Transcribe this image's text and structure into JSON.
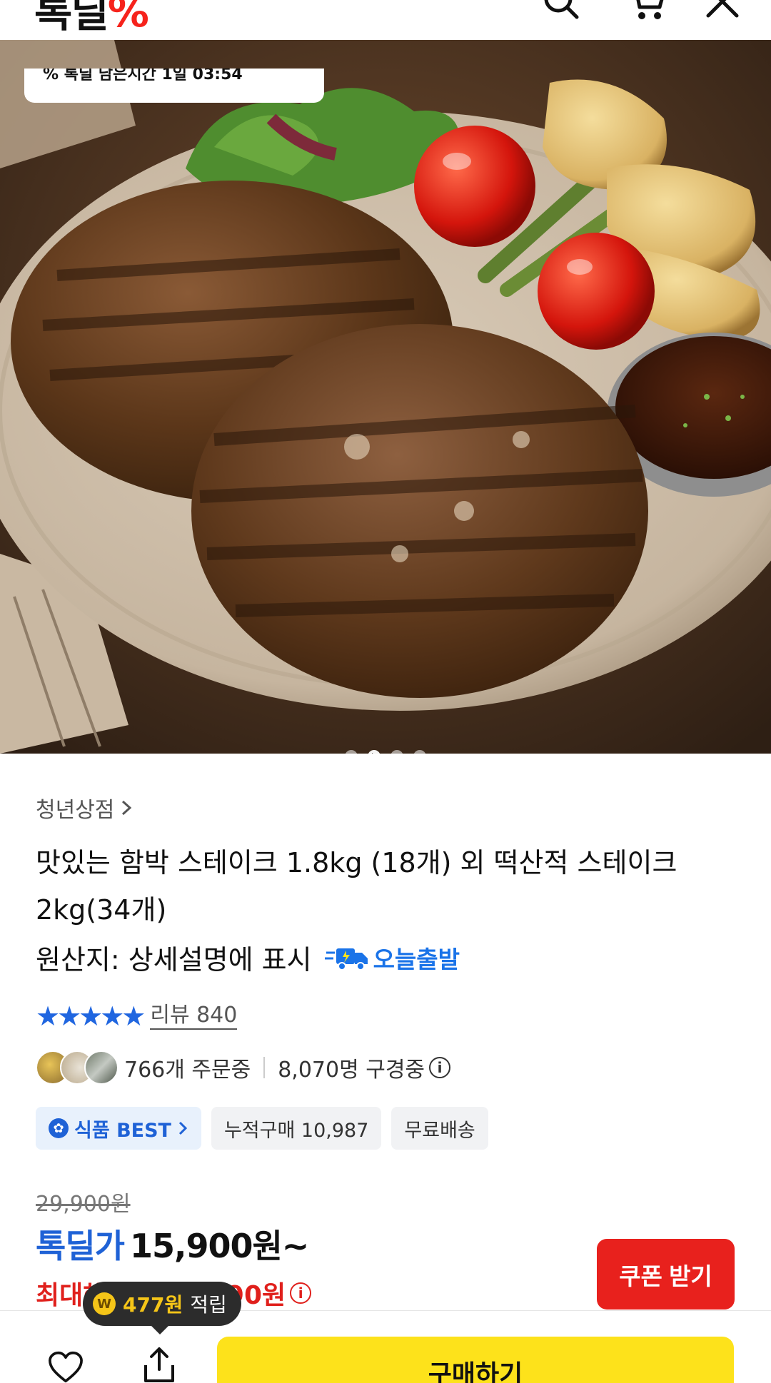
{
  "header": {
    "logo_text": "톡딜",
    "logo_symbol": "%",
    "icons": [
      "search-icon",
      "cart-icon",
      "close-icon"
    ]
  },
  "hero": {
    "promo_text": "% 톡딜 남은시간 1일 03:54",
    "carousel_count": 4,
    "carousel_active": 2
  },
  "product": {
    "store": "청년상점",
    "title": "맛있는 함박 스테이크 1.8kg (18개) 외 떡산적 스테이크 2kg(34개)",
    "origin": "원산지: 상세설명에 표시",
    "shipping_badge": "오늘출발",
    "stars": "★★★★★",
    "rating": 4.5,
    "review_label": "리뷰 840",
    "orders": "766개 주문중",
    "watchers": "8,070명 구경중",
    "tags": {
      "best": "식품 BEST",
      "cumulative": "누적구매 10,987",
      "free_shipping": "무료배송"
    }
  },
  "price": {
    "original": "29,900원",
    "deal_label": "톡딜가",
    "deal_price": "15,900원~",
    "max_benefit": "최대혜택가 15,790원"
  },
  "coupon_button": "쿠폰 받기",
  "tooltip": {
    "coin": "W",
    "amount": "477원",
    "suffix": "적립"
  },
  "bottom_bar": {
    "buy_label": "구매하기"
  },
  "colors": {
    "accent_blue": "#1f62d6",
    "accent_red": "#e8211d",
    "buy_yellow": "#fde21b"
  }
}
